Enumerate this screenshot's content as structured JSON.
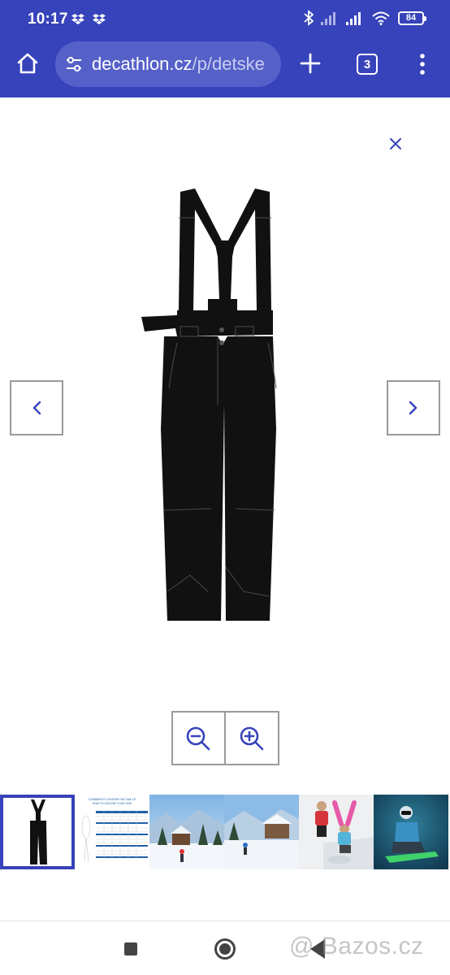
{
  "status_bar": {
    "time": "10:17",
    "battery": "84"
  },
  "browser": {
    "url_domain": "decathlon.cz",
    "url_path": "/p/detske",
    "tab_count": "3"
  },
  "gallery": {
    "icons": {
      "close": "close-icon",
      "prev": "chevron-left-icon",
      "next": "chevron-right-icon",
      "zoom_out": "zoom-out-icon",
      "zoom_in": "zoom-in-icon"
    },
    "accent_color": "#3643ba",
    "product_color": "#111111",
    "thumbnails": [
      {
        "subject": "black ski pants with suspenders"
      },
      {
        "subject": "size chart",
        "heading": "COMMENT CHOISIR SA TAILLE",
        "subheading": "HOW TO CHOOSE YOUR SIZE"
      },
      {
        "subject": "snowy mountain village"
      },
      {
        "subject": "children playing in snow"
      },
      {
        "subject": "child snowboarder"
      }
    ]
  },
  "watermark": "@ Bazos.cz"
}
